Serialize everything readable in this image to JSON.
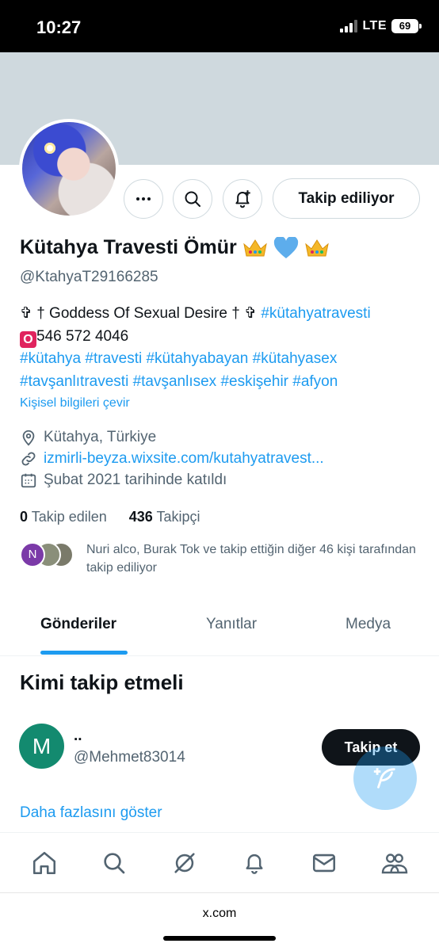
{
  "status_bar": {
    "time": "10:27",
    "network": "LTE",
    "battery": "69"
  },
  "profile": {
    "name": "Kütahya Travesti Ömür",
    "handle": "@KtahyaT29166285",
    "follow_button": "Takip ediliyor",
    "bio_line1_prefix": "✞ † Goddess Of Sexual Desire † ✞ ",
    "bio_line1_hashtag": "#kütahyatravesti",
    "bio_phone_badge": "O",
    "bio_phone": "546 572 4046",
    "bio_hashtags_line1": "#kütahya #travesti #kütahyabayan #kütahyasex",
    "bio_hashtags_line2": "#tavşanlıtravesti #tavşanlısex #eskişehir #afyon",
    "translate_bio": "Kişisel bilgileri çevir",
    "location": "Kütahya, Türkiye",
    "website": "izmirli-beyza.wixsite.com/kutahyatravest...",
    "joined": "Şubat 2021 tarihinde katıldı",
    "following_count": "0",
    "following_label": "Takip edilen",
    "followers_count": "436",
    "followers_label": "Takipçi",
    "known_followers_text": "Nuri alco, Burak Tok ve takip ettiğin diğer 46 kişi tarafından takip ediliyor",
    "known_avatar_initial": "N"
  },
  "tabs": [
    {
      "label": "Gönderiler",
      "active": true
    },
    {
      "label": "Yanıtlar",
      "active": false
    },
    {
      "label": "Medya",
      "active": false
    }
  ],
  "who_to_follow": {
    "title": "Kimi takip etmeli",
    "users": [
      {
        "initial": "M",
        "name": "..",
        "handle": "@Mehmet83014",
        "button": "Takip et"
      }
    ],
    "show_more": "Daha fazlasını göster"
  },
  "bottom_nav": [
    "home-icon",
    "search-icon",
    "grok-icon",
    "notifications-icon",
    "messages-icon",
    "communities-icon"
  ],
  "browser": {
    "url": "x.com"
  },
  "colors": {
    "accent": "#1d9bf0",
    "text": "#0f1419",
    "muted": "#536471",
    "banner": "#cfd9de"
  }
}
